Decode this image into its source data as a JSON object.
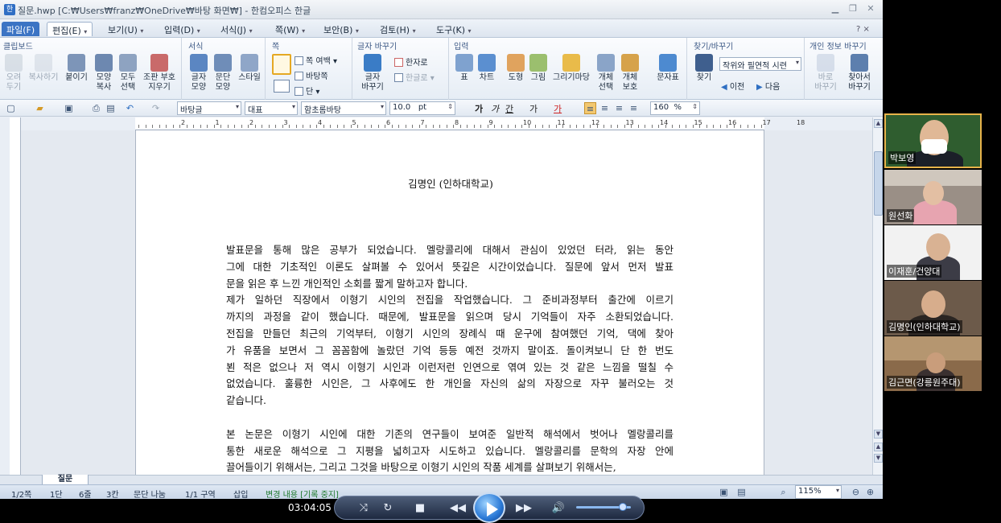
{
  "window": {
    "title": "질문.hwp [C:₩Users₩franz₩OneDrive₩바탕 화면₩] - 한컴오피스 한글",
    "app_icon": "한"
  },
  "menu": {
    "items": [
      "파일(F)",
      "편집(E)",
      "보기(U)",
      "입력(D)",
      "서식(J)",
      "쪽(W)",
      "보안(B)",
      "검토(H)",
      "도구(K)"
    ],
    "right": "? ×"
  },
  "ribbon": {
    "groups": [
      {
        "title": "클립보드",
        "buttons": [
          "오려\n두기",
          "복사하기",
          "붙이기",
          "모양\n복사",
          "모두\n선택",
          "조판 부호\n지우기"
        ]
      },
      {
        "title": "서식",
        "buttons": [
          "글자\n모양",
          "문단\n모양",
          "스타일"
        ]
      },
      {
        "title": "쪽",
        "buttons": [],
        "small": [
          "쪽 여백",
          "바탕쪽",
          "단"
        ]
      },
      {
        "title": "글자 바꾸기",
        "buttons": [
          "글자\n바꾸기"
        ],
        "small": [
          "한자로",
          "한글로"
        ]
      },
      {
        "title": "입력",
        "buttons": [
          "표",
          "차트",
          "도형",
          "그림",
          "그리기마당",
          "개체\n선택",
          "개체\n보호",
          "문자표"
        ]
      },
      {
        "title": "찾기/바꾸기",
        "buttons": [
          "찾기"
        ],
        "combo": "작위와 필연적 시련",
        "small": [
          "이전",
          "다음"
        ]
      },
      {
        "title": "개인 정보 바꾸기",
        "buttons": [
          "바로\n바꾸기",
          "찾아서\n바꾸기"
        ]
      }
    ]
  },
  "toolbar": {
    "style": "바탕글",
    "lang": "대표",
    "font": "함초롬바탕",
    "size": "10.0",
    "unit": "pt",
    "bold": "가",
    "italic": "가",
    "underline": "간",
    "strike": "가",
    "color": "가",
    "linespacing": "160",
    "percent": "%"
  },
  "ruler": {
    "numbers": [
      "2",
      "1",
      "2",
      "3",
      "4",
      "5",
      "6",
      "7",
      "8",
      "9",
      "10",
      "11",
      "12",
      "13",
      "14",
      "15",
      "16",
      "17",
      "18"
    ]
  },
  "document": {
    "author": "김명인 (인하대학교)",
    "lines": [
      "   발표문을 통해 많은 공부가 되었습니다. 멜랑콜리에 대해서 관심이 있었던 터라, 읽는 동안",
      "그에 대한 기초적인 이론도 살펴볼 수 있어서 뜻깊은 시간이었습니다. 질문에 앞서 먼저 발표",
      "문을 읽은 후 느낀 개인적인 소회를 짧게 말하고자 합니다.",
      "   제가 일하던 직장에서 이형기 시인의 전집을 작업했습니다. 그 준비과정부터 출간에 이르기",
      "까지의 과정을 같이 했습니다. 때문에, 발표문을 읽으며 당시 기억들이 자주 소환되었습니다.",
      "전집을 만들던 최근의 기억부터, 이형기 시인의 장례식 때 운구에 참여했던 기억, 댁에 찾아",
      "가 유품을 보면서 그 꼼꼼함에 놀랐던 기억 등등 예전 것까지 말이죠. 돌이켜보니 단 한 번도",
      "뵌 적은 없으나 저 역시 이형기 시인과 이런저런 인연으로 엮여 있는 것 같은 느낌을 떨칠 수",
      "없었습니다. 훌륭한 시인은, 그 사후에도 한 개인을 자신의 삶의 자장으로 자꾸 불러오는 것",
      "같습니다.",
      "",
      "   본 논문은 이형기 시인에 대한 기존의 연구들이 보여준 일반적 해석에서 벗어나 멜랑콜리를",
      "통한 새로운 해석으로 그 지평을 넓히고자 시도하고 있습니다. 멜랑콜리를 문학의 자장 안에",
      "끌어들이기 위해서는, 그리고 그것을 바탕으로 이형기 시인의 작품 세계를 살펴보기 위해서는,"
    ]
  },
  "tabs": {
    "current": "질문"
  },
  "status": {
    "page": "1/2쪽",
    "column": "1단",
    "line": "6줄",
    "col": "3칸",
    "break": "문단 나눔",
    "section": "1/1 구역",
    "mode": "삽입",
    "track": "변경 내용 [기록 중지]",
    "zoom": "115%"
  },
  "participants": [
    {
      "name": "박보영"
    },
    {
      "name": "원선화"
    },
    {
      "name": "이재훈/건양대"
    },
    {
      "name": "김명인(인하대학교)"
    },
    {
      "name": "김근면(강릉원주대)"
    }
  ],
  "player": {
    "time": "03:04:05",
    "volume": 0.85
  },
  "colors": {
    "accent": "#3b74c4",
    "player": "#2a79d6",
    "track_change": "#1f7a2e"
  }
}
